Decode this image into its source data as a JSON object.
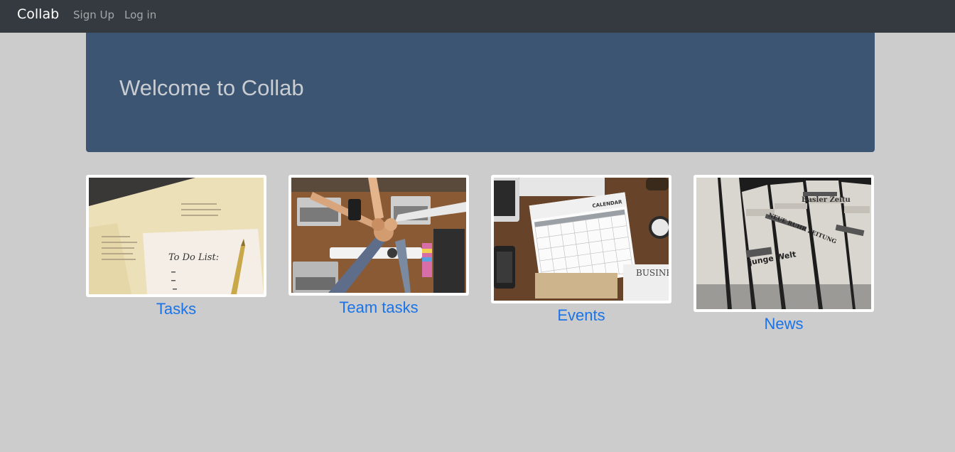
{
  "nav": {
    "brand": "Collab",
    "signup": "Sign Up",
    "login": "Log in"
  },
  "jumbotron": {
    "title": "Welcome to Collab"
  },
  "cards": [
    {
      "label": "Tasks",
      "image_text": "To Do List:",
      "icon": "todo-list-image"
    },
    {
      "label": "Team tasks",
      "icon": "team-fist-bump-image"
    },
    {
      "label": "Events",
      "image_text": "CALENDAR",
      "icon": "calendar-image"
    },
    {
      "label": "News",
      "icon": "newspapers-image"
    }
  ],
  "colors": {
    "navbar": "#343a40",
    "jumbotron": "#3c5573",
    "background": "#cccccc",
    "link": "#1a73e8"
  }
}
